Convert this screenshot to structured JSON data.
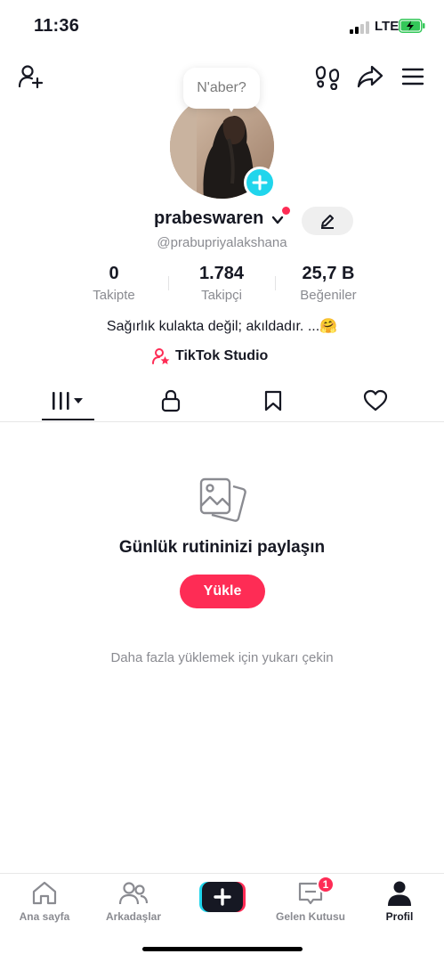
{
  "status_bar": {
    "time": "11:36",
    "network": "LTE",
    "signal_bars_active": 2,
    "battery_charging": true
  },
  "top_nav": {
    "icons": [
      "add-user-icon",
      "footprint-icon",
      "share-icon",
      "menu-icon"
    ]
  },
  "profile": {
    "bubble_text": "N'aber?",
    "username": "prabeswaren",
    "handle": "@prabupriyalakshana",
    "stats": [
      {
        "value": "0",
        "label": "Takipte"
      },
      {
        "value": "1.784",
        "label": "Takipçi"
      },
      {
        "value": "25,7 B",
        "label": "Beğeniler"
      }
    ],
    "bio": "Sağırlık kulakta değil; akıldadır. ...🤗",
    "studio_link": "TikTok Studio"
  },
  "tabs": {
    "icons": [
      "videos-grid-icon",
      "lock-icon",
      "bookmark-icon",
      "heart-icon"
    ],
    "active_index": 0
  },
  "empty_state": {
    "title": "Günlük rutininizi paylaşın",
    "button": "Yükle",
    "hint": "Daha fazla yüklemek için yukarı çekin"
  },
  "bottom_nav": {
    "items": [
      {
        "label": "Ana sayfa",
        "icon": "home-icon"
      },
      {
        "label": "Arkadaşlar",
        "icon": "friends-icon"
      },
      {
        "label": "",
        "icon": "create-icon"
      },
      {
        "label": "Gelen Kutusu",
        "icon": "inbox-icon"
      },
      {
        "label": "Profil",
        "icon": "profile-icon"
      }
    ],
    "inbox_badge": "1",
    "active": "Profil"
  },
  "colors": {
    "accent": "#fe2c55",
    "cyan": "#20d5ec",
    "text": "#161823",
    "muted": "#8a8b91"
  }
}
